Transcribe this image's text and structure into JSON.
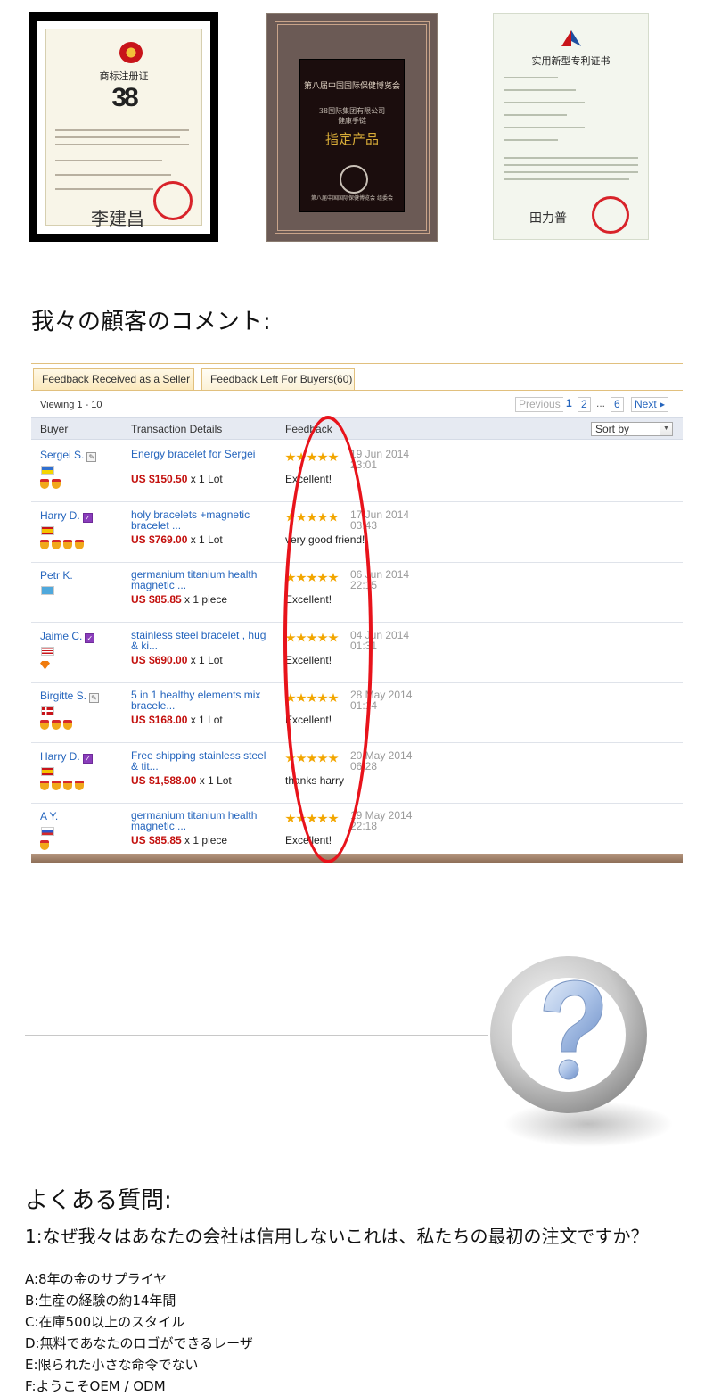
{
  "certificates": {
    "trademark": {
      "title": "商标注册证",
      "logo_text": "38",
      "signature": "李建昌"
    },
    "award": {
      "title": "第八届中国国际保健博览会",
      "company": "38国际集团有限公司",
      "product": "健康手链",
      "gold_text": "指定产品",
      "footer": "第八届中国国际保健博览会 组委会"
    },
    "patent": {
      "title": "实用新型专利证书",
      "signature": "田力普"
    }
  },
  "comments_heading": "我々の顧客のコメント:",
  "feedback": {
    "tabs": [
      "Feedback Received as a Seller",
      "Feedback Left For Buyers(60)"
    ],
    "viewing": "Viewing 1 - 10",
    "pager": {
      "previous": "Previous",
      "pages": [
        "1",
        "2"
      ],
      "dots": "...",
      "last": "6",
      "next": "Next"
    },
    "columns": {
      "buyer": "Buyer",
      "details": "Transaction Details",
      "feedback": "Feedback"
    },
    "sort_label": "Sort by",
    "rows": [
      {
        "buyer": "Sergei S.",
        "badge": "gray",
        "flag": "ua",
        "medals": 2,
        "product": "Energy bracelet for Sergei",
        "price": "US $150.50",
        "qty": " x 1 Lot",
        "stars": 5,
        "date": "19 Jun 2014\n23:01",
        "comment": "Excellent!"
      },
      {
        "buyer": "Harry D.",
        "badge": "purple",
        "flag": "es",
        "medals": 4,
        "product": "holy bracelets +magnetic bracelet ...",
        "price": "US $769.00",
        "qty": " x 1 Lot",
        "stars": 5,
        "date": "17 Jun 2014\n03:43",
        "comment": "very good friend!"
      },
      {
        "buyer": "Petr K.",
        "badge": "none",
        "flag": "kz",
        "medals": 0,
        "product": "germanium titanium health magnetic ...",
        "price": "US $85.85",
        "qty": " x 1 piece",
        "stars": 5,
        "date": "06 Jun 2014\n22:15",
        "comment": "Excellent!"
      },
      {
        "buyer": "Jaime C.",
        "badge": "purple",
        "flag": "us",
        "medals": 0,
        "gem": true,
        "product": "stainless steel bracelet , hug & ki...",
        "price": "US $690.00",
        "qty": " x 1 Lot",
        "stars": 5,
        "date": "04 Jun 2014\n01:31",
        "comment": "Excellent!"
      },
      {
        "buyer": "Birgitte S.",
        "badge": "gray",
        "flag": "dk",
        "medals": 3,
        "product": "5 in 1 healthy elements mix bracele...",
        "price": "US $168.00",
        "qty": " x 1 Lot",
        "stars": 5,
        "date": "28 May 2014\n01:14",
        "comment": "Excellent!"
      },
      {
        "buyer": "Harry D.",
        "badge": "purple",
        "flag": "es",
        "medals": 4,
        "product": "Free shipping stainless steel & tit...",
        "price": "US $1,588.00",
        "qty": " x 1 Lot",
        "stars": 5,
        "date": "20 May 2014\n06:28",
        "comment": "thanks harry"
      },
      {
        "buyer": "A Y.",
        "badge": "none",
        "flag": "ru",
        "medals": 1,
        "product": "germanium titanium health magnetic ...",
        "price": "US $85.85",
        "qty": " x 1 piece",
        "stars": 5,
        "date": "19 May 2014\n22:18",
        "comment": "Excellent!"
      }
    ]
  },
  "colors": {
    "link_blue": "#2565bd",
    "price_red": "#c3100d",
    "highlight_ellipse": "#e8131b",
    "tab_border": "#e1c07e"
  },
  "faq": {
    "heading": "よくある質問:",
    "question": "1:なぜ我々はあなたの会社は信用しないこれは、私たちの最初の注文ですか？",
    "answers": [
      "A:8年の金のサプライヤ",
      "B:生産の経験の約14年間",
      "C:在庫500以上のスタイル",
      "D:無料であなたのロゴができるレーザ",
      "E:限られた小さな命令でない",
      "F:ようこそOEM / ODM"
    ]
  }
}
